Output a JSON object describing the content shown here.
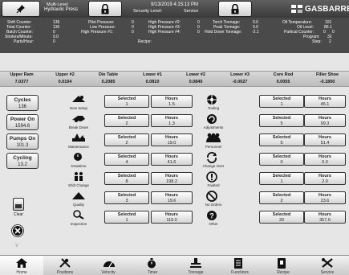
{
  "header": {
    "multi_level_1": "Multi-Level",
    "multi_level_2": "Hydraulic Press",
    "datetime": "9/13/2019 4:15:13 PM",
    "security_label": "Security Level:",
    "security_value": "Service",
    "brand": "GASBARRE"
  },
  "stats": {
    "shift_counter": {
      "label": "Shift Counter:",
      "value": "136"
    },
    "total_counter": {
      "label": "Total Counter:",
      "value": "136"
    },
    "batch_counter": {
      "label": "Batch Counter:",
      "value": "0"
    },
    "strokes_minute": {
      "label": "Strokes/Minute:",
      "value": "0.0"
    },
    "parts_hour": {
      "label": "Parts/Hour:",
      "value": "0"
    },
    "pilot_pressure": {
      "label": "Pilot Pressure:",
      "value": "0"
    },
    "low_pressure": {
      "label": "Low Pressure:",
      "value": "0"
    },
    "high_pressure_1": {
      "label": "High Pressure #1:",
      "value": "0"
    },
    "high_pressure_2": {
      "label": "High Pressure #2:",
      "value": "0"
    },
    "high_pressure_3": {
      "label": "High Pressure #3:",
      "value": "0"
    },
    "high_pressure_4": {
      "label": "High Pressure #4:",
      "value": "0"
    },
    "recipe_label": "Recipe:",
    "tonnage_torch": {
      "label": "Torch Tonnage:",
      "value": "0.0"
    },
    "peak_tonnage": {
      "label": "Peak Tonnage:",
      "value": "0.0"
    },
    "hold_down_tonnage": {
      "label": "Hold Down Tonnage:",
      "value": "-2.1"
    },
    "oil_temperature": {
      "label": "Oil Temperature:",
      "value": "101"
    },
    "oil_level": {
      "label": "Oil Level:",
      "value": "86.1"
    },
    "partical_counter": {
      "label": "Partical Counter:",
      "value": "0"
    },
    "partical_counter_2": "0",
    "program": {
      "label": "Program:",
      "value": "32"
    },
    "step": {
      "label": "Step:",
      "value": "2"
    }
  },
  "positions": [
    {
      "name": "Upper Ram",
      "value": "7.0377"
    },
    {
      "name": "Upper #2",
      "value": "0.0104"
    },
    {
      "name": "Die Table",
      "value": "0.2085"
    },
    {
      "name": "Lower #1",
      "value": "0.0810"
    },
    {
      "name": "Lower #2",
      "value": "0.0840"
    },
    {
      "name": "Lower #3",
      "value": "-0.0027"
    },
    {
      "name": "Core Rod",
      "value": "0.0055"
    },
    {
      "name": "Filler Shoe",
      "value": "-0.1800"
    }
  ],
  "counters": [
    {
      "label": "Cycles",
      "value": "136"
    },
    {
      "label": "Power On",
      "value": "1594.6"
    },
    {
      "label": "Pumps On",
      "value": "101.3"
    },
    {
      "label": "Cycling",
      "value": "13.2"
    }
  ],
  "clear_label": "Clear",
  "box_headers": {
    "selected": "Selected",
    "hours": "Hours"
  },
  "left_rows": [
    {
      "label": "New Setup",
      "selected": "1",
      "hours": "1.5"
    },
    {
      "label": "Break Down",
      "selected": "2",
      "hours": "1.3"
    },
    {
      "label": "Maintenance",
      "selected": "2",
      "hours": "19.0"
    },
    {
      "label": "Drawtime",
      "selected": "4",
      "hours": "41.6"
    },
    {
      "label": "Shift Change",
      "selected": "8",
      "hours": "198.2"
    },
    {
      "label": "Quality",
      "selected": "3",
      "hours": "19.6"
    },
    {
      "label": "Inspection",
      "selected": "1",
      "hours": "119.0"
    }
  ],
  "right_rows": [
    {
      "label": "Tooling",
      "selected": "1",
      "hours": "45.1"
    },
    {
      "label": "Adjustments",
      "selected": "5",
      "hours": "99.3"
    },
    {
      "label": "Personnel",
      "selected": "5",
      "hours": "51.4"
    },
    {
      "label": "Change Over",
      "selected": "0",
      "hours": "0.0"
    },
    {
      "label": "Faulted",
      "selected": "1",
      "hours": "2.0"
    },
    {
      "label": "No Orders",
      "selected": "2",
      "hours": "23.6"
    },
    {
      "label": "Other",
      "selected": "20",
      "hours": "357.6"
    }
  ],
  "tabs": [
    {
      "label": "Home",
      "icon": "home-icon"
    },
    {
      "label": "Positions",
      "icon": "tools-icon"
    },
    {
      "label": "Velocity",
      "icon": "gauge-icon"
    },
    {
      "label": "Timer",
      "icon": "stopwatch-icon"
    },
    {
      "label": "Tonnage",
      "icon": "press-icon"
    },
    {
      "label": "Functions",
      "icon": "document-icon"
    },
    {
      "label": "Recipe",
      "icon": "recipe-icon"
    },
    {
      "label": "Service",
      "icon": "wrench-icon"
    }
  ],
  "colors": {
    "header": "#4a4a4a",
    "panel": "#e6e6e6",
    "button": "#f2f2f2"
  }
}
